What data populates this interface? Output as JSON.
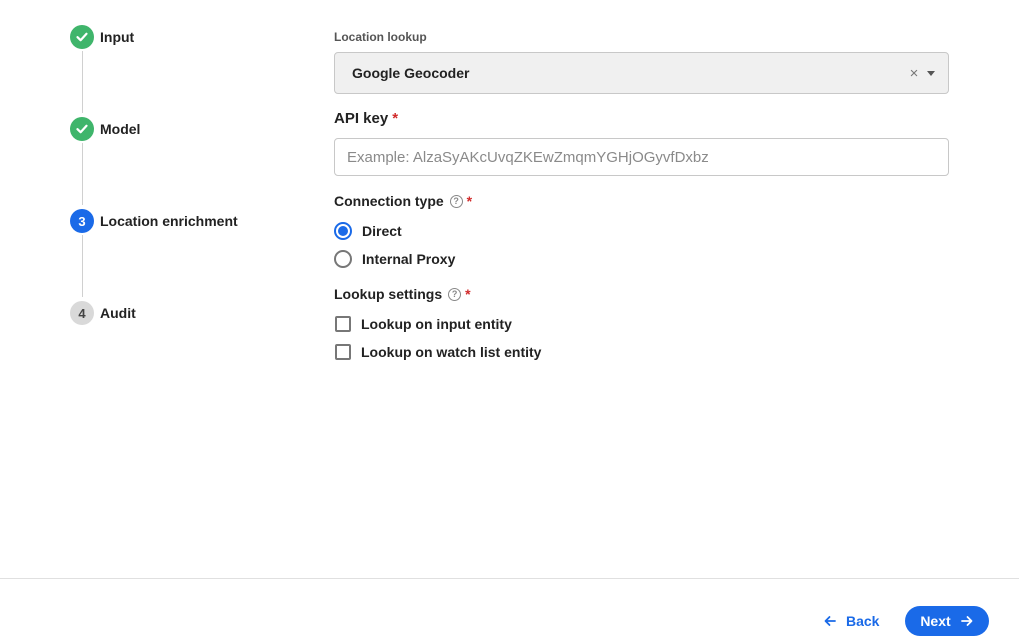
{
  "stepper": {
    "steps": [
      {
        "number": "",
        "label": "Input",
        "status": "complete",
        "icon": "check-icon"
      },
      {
        "number": "",
        "label": "Model",
        "status": "complete",
        "icon": "check-icon"
      },
      {
        "number": "3",
        "label": "Location enrichment",
        "status": "active"
      },
      {
        "number": "4",
        "label": "Audit",
        "status": "pending"
      }
    ]
  },
  "form": {
    "location_lookup": {
      "caption": "Location lookup",
      "value": "Google Geocoder",
      "clear_icon": "close-icon",
      "caret_icon": "chevron-down-icon"
    },
    "api_key": {
      "label": "API key",
      "required": "*",
      "value": "",
      "placeholder": "Example: AlzaSyAKcUvqZKEwZmqmYGHjOGyvfDxbz"
    },
    "connection_type": {
      "label": "Connection type",
      "help_icon": "question-circle-icon",
      "required": "*",
      "options": [
        {
          "label": "Direct",
          "checked": true
        },
        {
          "label": "Internal Proxy",
          "checked": false
        }
      ]
    },
    "lookup_settings": {
      "label": "Lookup settings",
      "help_icon": "question-circle-icon",
      "required": "*",
      "options": [
        {
          "label": "Lookup on input entity",
          "checked": false
        },
        {
          "label": "Lookup on watch list entity",
          "checked": false
        }
      ]
    }
  },
  "footer": {
    "back_label": "Back",
    "back_icon": "arrow-left-icon",
    "next_label": "Next",
    "next_icon": "arrow-right-icon"
  },
  "colors": {
    "accent": "#1a6ae8",
    "complete": "#3fb56b",
    "required": "#d12a2a"
  }
}
